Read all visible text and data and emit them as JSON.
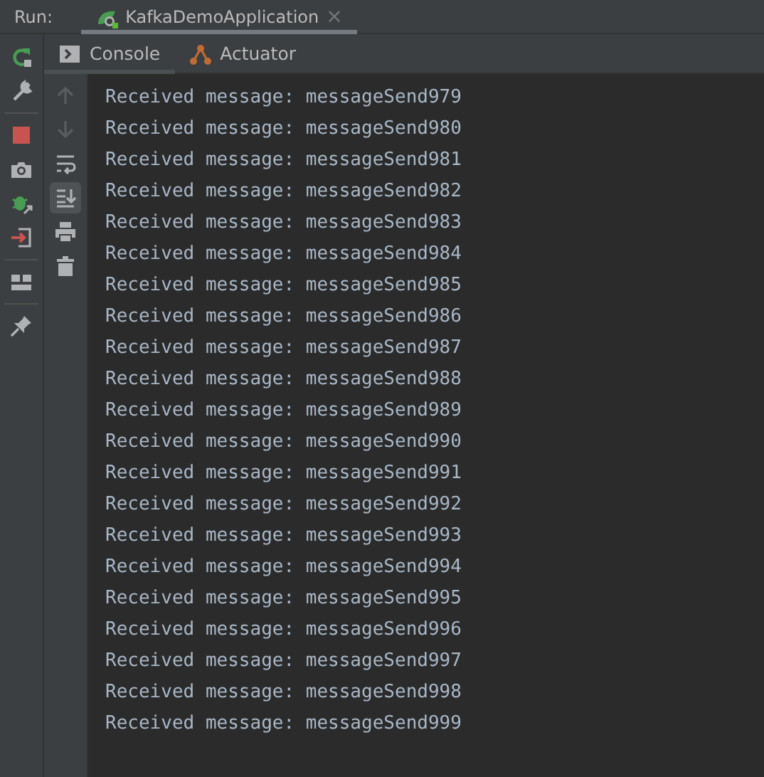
{
  "run_label": "Run:",
  "run_tabs": [
    {
      "title": "KafkaDemoApplication",
      "selected": true,
      "close": "×"
    }
  ],
  "console_tabs": [
    {
      "label": "Console",
      "kind": "console",
      "selected": true
    },
    {
      "label": "Actuator",
      "kind": "actuator",
      "selected": false
    }
  ],
  "left_tools": [
    {
      "kind": "rerun"
    },
    {
      "kind": "wrench"
    },
    {
      "kind": "sep"
    },
    {
      "kind": "stop"
    },
    {
      "kind": "camera"
    },
    {
      "kind": "debug"
    },
    {
      "kind": "exit"
    },
    {
      "kind": "sep"
    },
    {
      "kind": "layout"
    },
    {
      "kind": "sep"
    },
    {
      "kind": "pin"
    }
  ],
  "console_tools": [
    {
      "kind": "up",
      "disabled": true,
      "selected": false
    },
    {
      "kind": "down",
      "disabled": true,
      "selected": false
    },
    {
      "kind": "wrap",
      "disabled": false,
      "selected": false
    },
    {
      "kind": "scroll-end",
      "disabled": false,
      "selected": true
    },
    {
      "kind": "print",
      "disabled": false,
      "selected": false
    },
    {
      "kind": "trash",
      "disabled": false,
      "selected": false
    }
  ],
  "lines": [
    "Received message: messageSend979",
    "Received message: messageSend980",
    "Received message: messageSend981",
    "Received message: messageSend982",
    "Received message: messageSend983",
    "Received message: messageSend984",
    "Received message: messageSend985",
    "Received message: messageSend986",
    "Received message: messageSend987",
    "Received message: messageSend988",
    "Received message: messageSend989",
    "Received message: messageSend990",
    "Received message: messageSend991",
    "Received message: messageSend992",
    "Received message: messageSend993",
    "Received message: messageSend994",
    "Received message: messageSend995",
    "Received message: messageSend996",
    "Received message: messageSend997",
    "Received message: messageSend998",
    "Received message: messageSend999"
  ]
}
